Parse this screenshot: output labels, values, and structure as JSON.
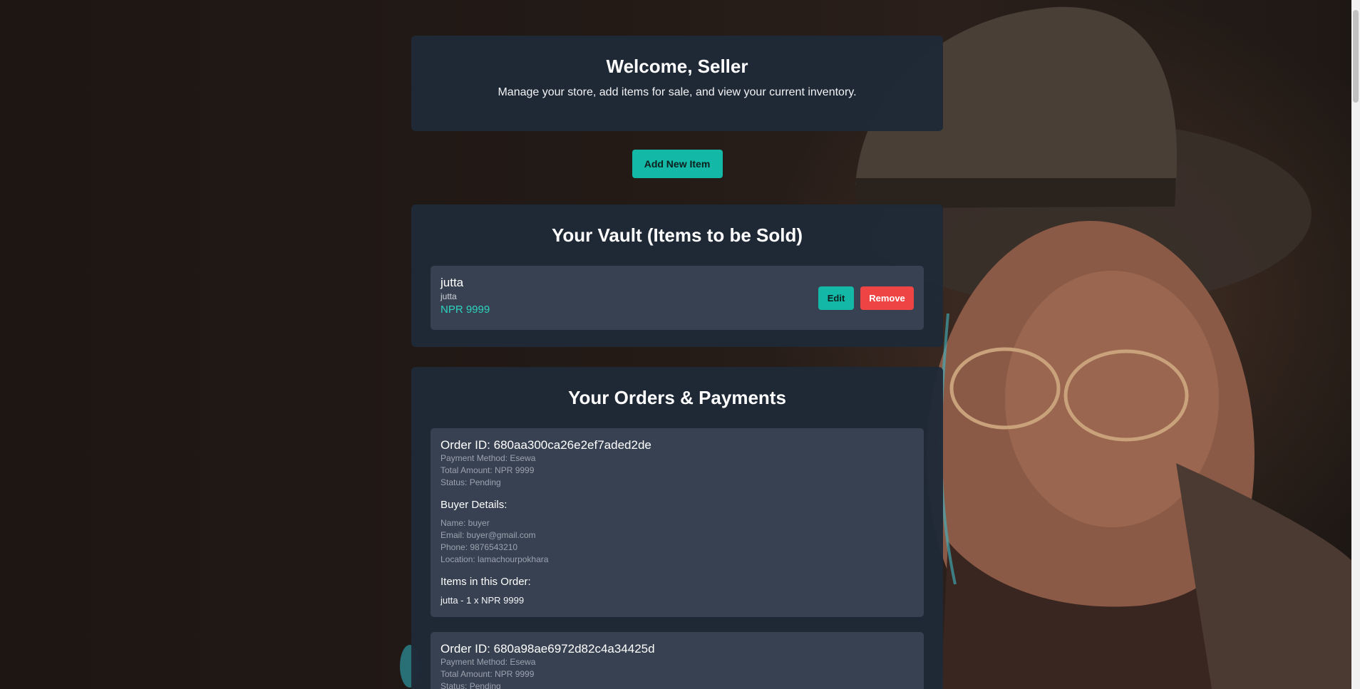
{
  "welcome": {
    "title": "Welcome, Seller",
    "subtitle": "Manage your store, add items for sale, and view your current inventory."
  },
  "actions": {
    "add_item_label": "Add New Item"
  },
  "vault": {
    "title": "Your Vault (Items to be Sold)",
    "items": [
      {
        "name": "jutta",
        "description": "jutta",
        "price": "NPR 9999",
        "edit_label": "Edit",
        "remove_label": "Remove"
      }
    ]
  },
  "orders": {
    "title": "Your Orders & Payments",
    "list": [
      {
        "order_id": "Order ID: 680aa300ca26e2ef7aded2de",
        "payment_method": "Payment Method: Esewa",
        "total_amount": "Total Amount: NPR 9999",
        "status": "Status: Pending",
        "buyer_heading": "Buyer Details:",
        "buyer_name": "Name: buyer",
        "buyer_email": "Email: buyer@gmail.com",
        "buyer_phone": "Phone: 9876543210",
        "buyer_location": "Location: lamachourpokhara",
        "items_heading": "Items in this Order:",
        "items": [
          "jutta - 1 x NPR 9999"
        ]
      },
      {
        "order_id": "Order ID: 680a98ae6972d82c4a34425d",
        "payment_method": "Payment Method: Esewa",
        "total_amount": "Total Amount: NPR 9999",
        "status": "Status: Pending"
      }
    ]
  },
  "colors": {
    "accent": "#14b8a6",
    "danger": "#ef4444",
    "card_bg": "#1f2937",
    "item_bg": "#374151"
  }
}
